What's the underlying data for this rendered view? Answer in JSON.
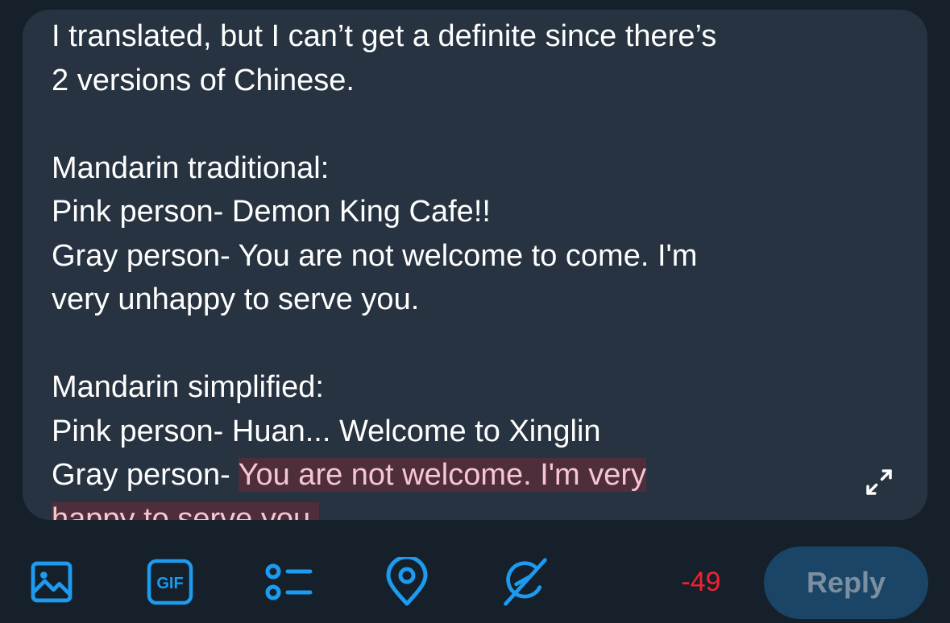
{
  "composer": {
    "lines": [
      "I translated, but I can’t get a definite since there’s",
      "2 versions of Chinese.",
      "",
      "Mandarin traditional:",
      "Pink person- Demon King Cafe!!",
      "Gray person- You are not welcome to come. I'm",
      "very unhappy to serve you.",
      "",
      "Mandarin simplified:",
      "Pink person- Huan... Welcome to Xinglin"
    ],
    "last_prefix": "Gray person- ",
    "overflow_text_line1": "You are not welcome. I'm very",
    "overflow_text_line2": "happy to serve you."
  },
  "toolbar": {
    "icons": [
      "image-icon",
      "gif-icon",
      "poll-icon",
      "location-icon",
      "grok-icon"
    ],
    "gif_label": "GIF",
    "char_count": "-49",
    "reply_label": "Reply"
  },
  "colors": {
    "background": "#15202b",
    "composer_bg": "#273340",
    "accent": "#1d9bf0",
    "over_limit": "#f4212e",
    "highlight_bg": "#4f2e3b"
  }
}
